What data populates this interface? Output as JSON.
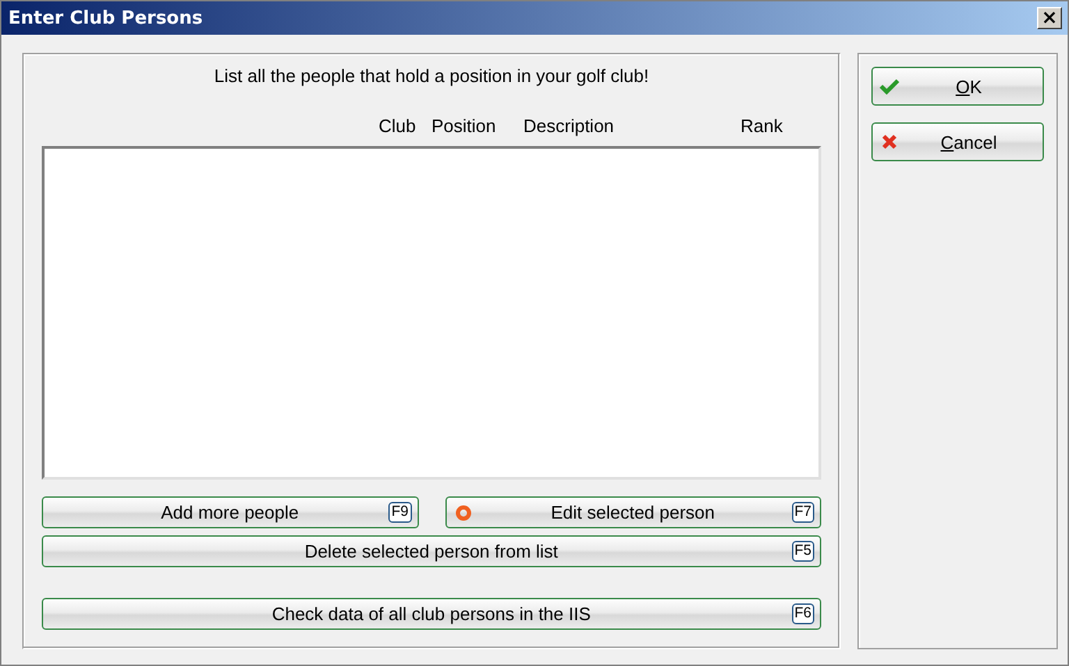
{
  "window": {
    "title": "Enter Club Persons",
    "close": "×"
  },
  "instruction": "List all the people that hold a position in your golf club!",
  "table": {
    "columns": [
      "Club",
      "Position",
      "Description",
      "Rank"
    ]
  },
  "buttons": [
    {
      "label": "Add more people",
      "key": "F9",
      "kind": "plain"
    },
    {
      "label": "Edit selected person",
      "key": "F7",
      "kind": "ring"
    },
    {
      "label": "Delete selected person from list",
      "key": "F5",
      "kind": "plain"
    },
    {
      "label": "Check data of all club persons in the IIS",
      "key": "F6",
      "kind": "plain"
    }
  ],
  "side_buttons": [
    {
      "label": "OK",
      "kind": "check",
      "underline_first": true
    },
    {
      "label": "Cancel",
      "kind": "cross",
      "underline_first": true
    }
  ]
}
